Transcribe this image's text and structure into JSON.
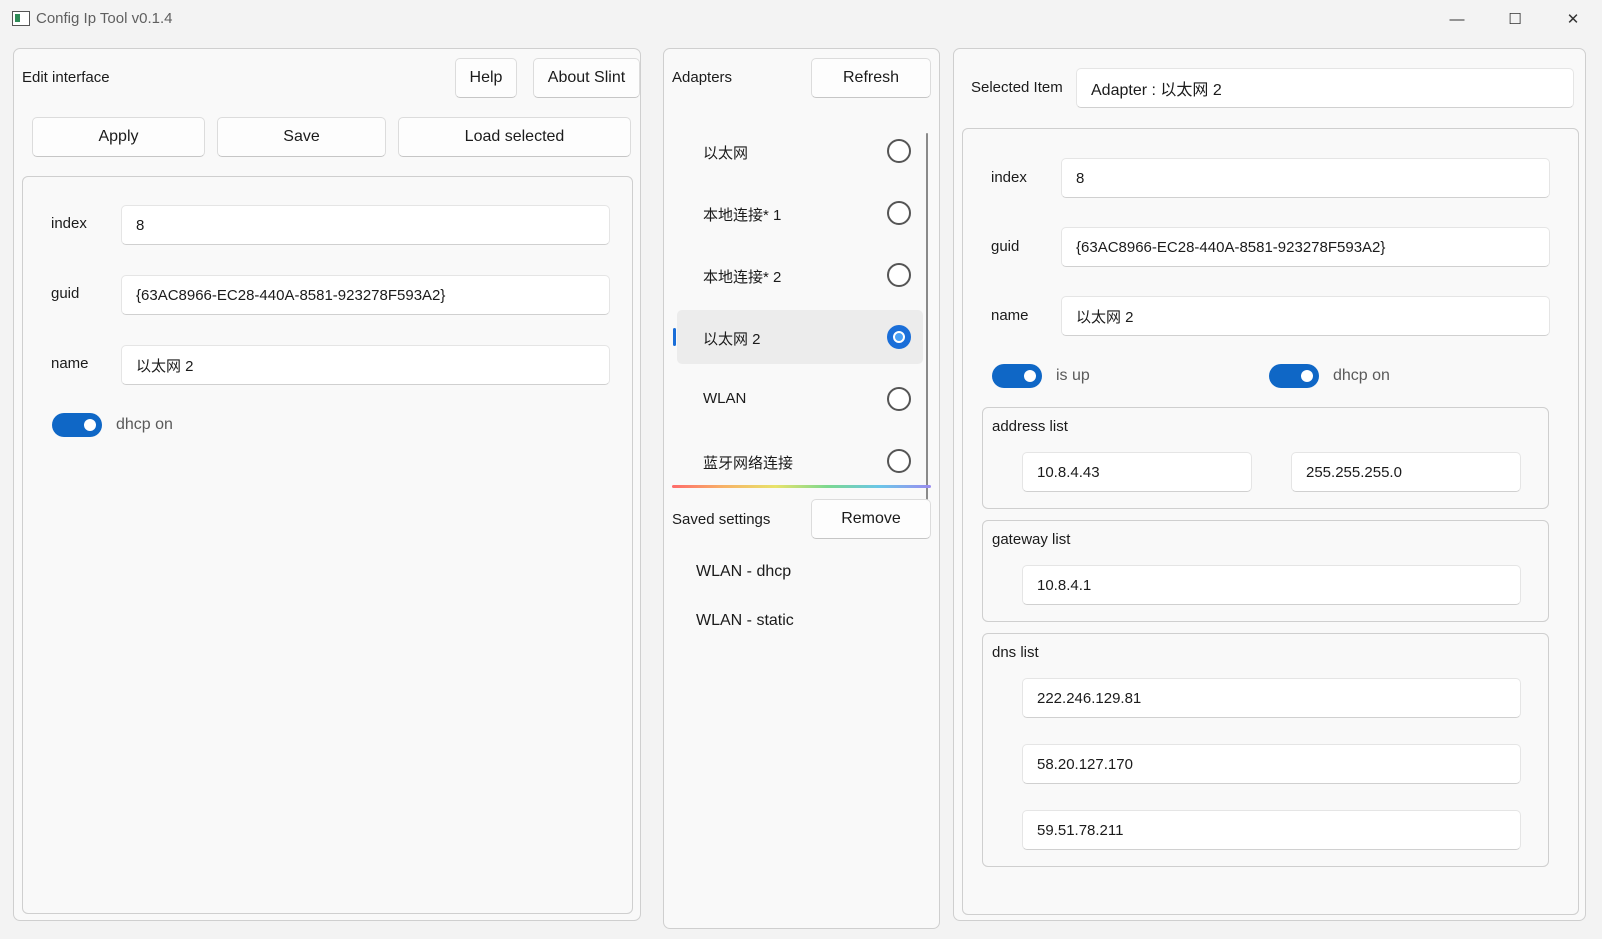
{
  "window": {
    "title": "Config Ip Tool v0.1.4",
    "minimize": "—",
    "maximize": "☐",
    "close": "✕"
  },
  "edit": {
    "title": "Edit interface",
    "help_label": "Help",
    "about_label": "About Slint",
    "apply_label": "Apply",
    "save_label": "Save",
    "load_label": "Load selected",
    "index_label": "index",
    "index_value": "8",
    "guid_label": "guid",
    "guid_value": "{63AC8966-EC28-440A-8581-923278F593A2}",
    "name_label": "name",
    "name_value": "以太网 2",
    "dhcp_label": "dhcp on",
    "dhcp_on": true
  },
  "adapters": {
    "title": "Adapters",
    "refresh_label": "Refresh",
    "items": [
      {
        "label": "以太网",
        "checked": false
      },
      {
        "label": "本地连接* 1",
        "checked": false
      },
      {
        "label": "本地连接* 2",
        "checked": false
      },
      {
        "label": "以太网 2",
        "checked": true
      },
      {
        "label": "WLAN",
        "checked": false
      },
      {
        "label": "蓝牙网络连接",
        "checked": false
      }
    ]
  },
  "saved": {
    "title": "Saved settings",
    "remove_label": "Remove",
    "items": [
      "WLAN - dhcp",
      "WLAN - static"
    ]
  },
  "details": {
    "selected_label": "Selected Item",
    "selected_value": "Adapter : 以太网 2",
    "index_label": "index",
    "index_value": "8",
    "guid_label": "guid",
    "guid_value": "{63AC8966-EC28-440A-8581-923278F593A2}",
    "name_label": "name",
    "name_value": "以太网 2",
    "isup_label": "is up",
    "dhcp_label": "dhcp on",
    "address_title": "address list",
    "address": "10.8.4.43",
    "mask": "255.255.255.0",
    "gateway_title": "gateway list",
    "gateway": "10.8.4.1",
    "dns_title": "dns list",
    "dns": [
      "222.246.129.81",
      "58.20.127.170",
      "59.51.78.211"
    ]
  },
  "colors": {
    "accent": "#0f67c6",
    "radio_accent": "#1a6ed8"
  }
}
